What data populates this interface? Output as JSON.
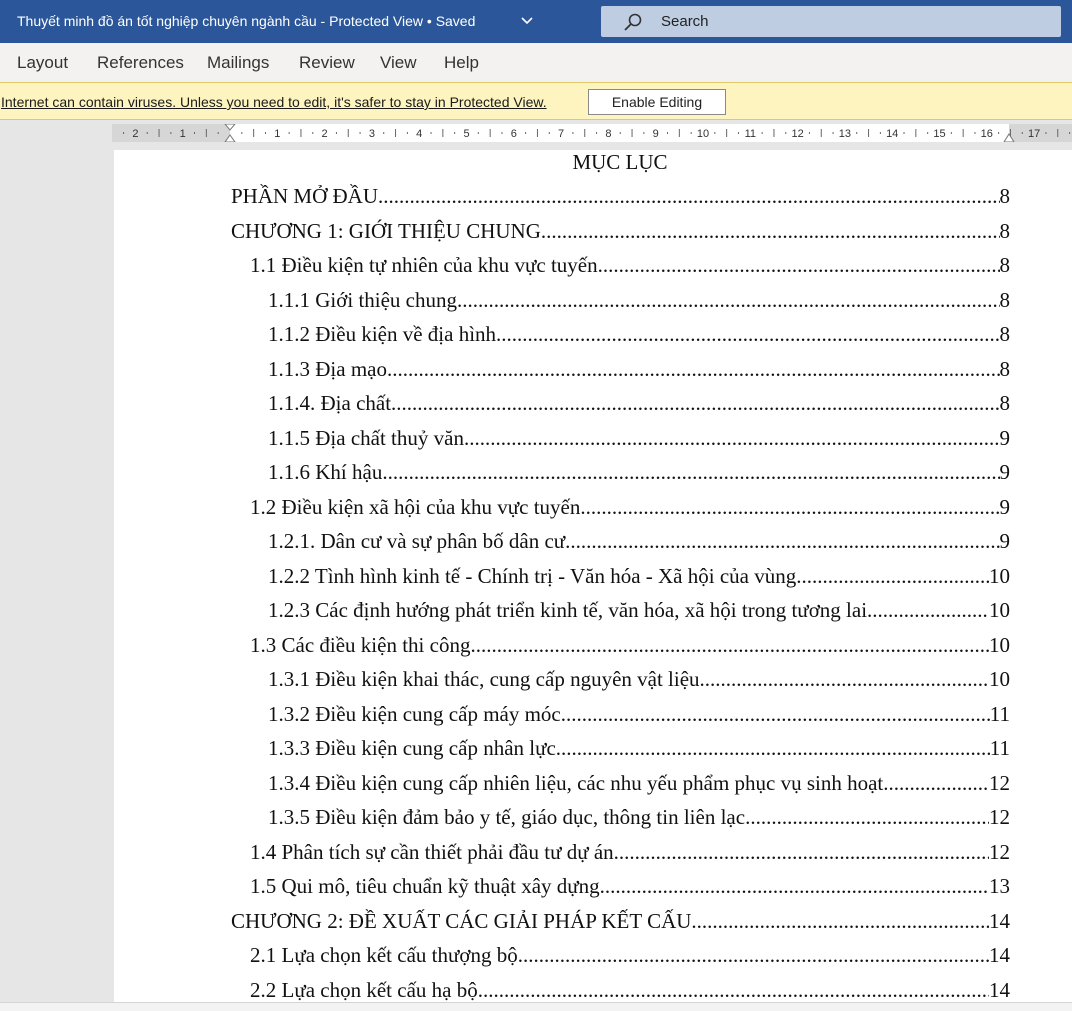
{
  "titlebar": {
    "title": "Thuyết minh đồ án tốt nghiệp chuyên ngành cầu  -  Protected View • Saved",
    "search_label": "Search"
  },
  "ribbon": {
    "tabs": [
      "Layout",
      "References",
      "Mailings",
      "Review",
      "View",
      "Help"
    ]
  },
  "message_bar": {
    "text": "Internet can contain viruses. Unless you need to edit, it's safer to stay in Protected View.",
    "button_label": "Enable Editing"
  },
  "ruler": {
    "labels": [
      "2",
      "1",
      "1",
      "2",
      "3",
      "4",
      "5",
      "6",
      "7",
      "8",
      "9",
      "10",
      "11",
      "12",
      "13",
      "14",
      "15",
      "16",
      "17"
    ]
  },
  "document": {
    "toc_title": "MỤC LỤC",
    "entries": [
      {
        "level": 0,
        "label": "PHẦN MỞ ĐẦU",
        "page": "8"
      },
      {
        "level": 0,
        "label": "CHƯƠNG 1: GIỚI THIỆU CHUNG",
        "page": "8"
      },
      {
        "level": 1,
        "label": "1.1 Điều kiện tự nhiên của khu vực tuyến ",
        "page": "8"
      },
      {
        "level": 2,
        "label": "1.1.1 Giới thiệu chung ",
        "page": "8"
      },
      {
        "level": 2,
        "label": "1.1.2 Điều kiện về địa hình",
        "page": "8"
      },
      {
        "level": 2,
        "label": "1.1.3 Địa mạo ",
        "page": "8"
      },
      {
        "level": 2,
        "label": "1.1.4. Địa chất",
        "page": "8"
      },
      {
        "level": 2,
        "label": "1.1.5 Địa chất thuỷ văn",
        "page": "9"
      },
      {
        "level": 2,
        "label": "1.1.6 Khí hậu ",
        "page": "9"
      },
      {
        "level": 1,
        "label": "1.2 Điều kiện xã hội của khu vực tuyến",
        "page": "9"
      },
      {
        "level": 2,
        "label": "1.2.1. Dân cư và sự phân bố dân cư ",
        "page": "9"
      },
      {
        "level": 2,
        "label": "1.2.2 Tình hình kinh tế - Chính trị - Văn hóa - Xã hội của vùng ",
        "page": "10"
      },
      {
        "level": 2,
        "label": "1.2.3 Các định hướng phát triển kinh tế, văn hóa, xã hội trong tương lai ",
        "page": "10"
      },
      {
        "level": 1,
        "label": "1.3 Các điều kiện thi công ",
        "page": "10"
      },
      {
        "level": 2,
        "label": "1.3.1 Điều kiện khai thác, cung cấp nguyên vật liệu",
        "page": "10"
      },
      {
        "level": 2,
        "label": "1.3.2 Điều kiện cung cấp máy móc ",
        "page": "11"
      },
      {
        "level": 2,
        "label": "1.3.3 Điều kiện cung cấp nhân lực ",
        "page": "11"
      },
      {
        "level": 2,
        "label": "1.3.4 Điều kiện cung cấp nhiên liệu, các nhu yếu phẩm phục vụ sinh hoạt",
        "page": "12"
      },
      {
        "level": 2,
        "label": "1.3.5 Điều kiện đảm bảo y tế, giáo dục, thông tin liên lạc ",
        "page": "12"
      },
      {
        "level": 1,
        "label": "1.4 Phân tích sự cần thiết phải đầu tư dự án ",
        "page": "12"
      },
      {
        "level": 1,
        "label": "1.5 Qui mô, tiêu chuẩn kỹ thuật xây dựng",
        "page": "13"
      },
      {
        "level": 0,
        "label": "CHƯƠNG 2: ĐỀ XUẤT CÁC GIẢI PHÁP KẾT CẤU",
        "page": "14"
      },
      {
        "level": 1,
        "label": "2.1 Lựa chọn kết cấu thượng bộ ",
        "page": "14"
      },
      {
        "level": 1,
        "label": "2.2 Lựa chọn kết cấu hạ bộ ",
        "page": "14"
      }
    ]
  },
  "colors": {
    "titlebar": "#2b579a",
    "searchbox": "#bfcde3",
    "ribbon": "#f3f2f1",
    "message_bar": "#fdf4bf"
  }
}
